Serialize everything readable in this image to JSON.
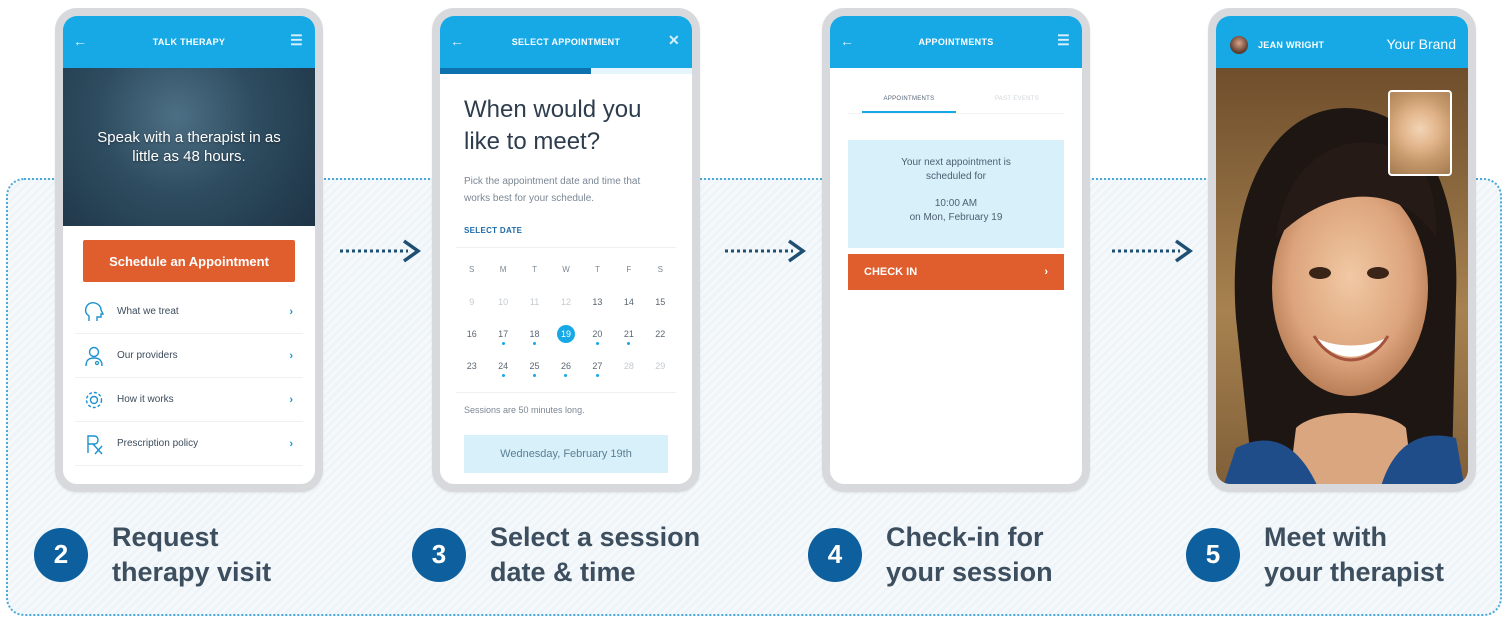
{
  "phone1": {
    "title": "TALK THERAPY",
    "hero_text": "Speak with a therapist in as little as 48 hours.",
    "schedule_button": "Schedule an Appointment",
    "menu_items": [
      {
        "label": "What we treat",
        "icon": "head-icon"
      },
      {
        "label": "Our providers",
        "icon": "doctor-icon"
      },
      {
        "label": "How it works",
        "icon": "gear-icon"
      },
      {
        "label": "Prescription policy",
        "icon": "rx-icon"
      }
    ]
  },
  "phone2": {
    "title": "SELECT APPOINTMENT",
    "progress": 0.6,
    "question": "When would you like to meet?",
    "subtitle": "Pick the appointment date and time that works best for your schedule.",
    "select_date_label": "SELECT DATE",
    "weekdays": [
      "S",
      "M",
      "T",
      "W",
      "T",
      "F",
      "S"
    ],
    "weeks": [
      [
        "9",
        "10",
        "11",
        "12",
        "13",
        "14",
        "15"
      ],
      [
        "16",
        "17",
        "18",
        "19",
        "20",
        "21",
        "22"
      ],
      [
        "23",
        "24",
        "25",
        "26",
        "27",
        "28",
        "29"
      ]
    ],
    "selected_day": "19",
    "sessions_note": "Sessions are 50 minutes long.",
    "selected_date_text": "Wednesday, February 19th"
  },
  "phone3": {
    "title": "APPOINTMENTS",
    "tab_active": "APPOINTMENTS",
    "tab_inactive": "PAST EVENTS",
    "next_appt_line1": "Your next appointment is",
    "next_appt_line2": "scheduled for",
    "appt_time": "10:00 AM",
    "appt_date": "on Mon, February 19",
    "checkin_button": "CHECK IN"
  },
  "phone4": {
    "caller_name": "JEAN WRIGHT",
    "brand": "Your Brand"
  },
  "steps": [
    {
      "number": "2",
      "line1": "Request",
      "line2": "therapy visit"
    },
    {
      "number": "3",
      "line1": "Select a session",
      "line2": "date & time"
    },
    {
      "number": "4",
      "line1": "Check-in for",
      "line2": "your session"
    },
    {
      "number": "5",
      "line1": "Meet with",
      "line2": "your therapist"
    }
  ],
  "colors": {
    "header_blue": "#16a9e6",
    "accent_orange": "#e05d2e",
    "step_circle": "#0d5f9d",
    "arrow": "#1f4f73"
  }
}
